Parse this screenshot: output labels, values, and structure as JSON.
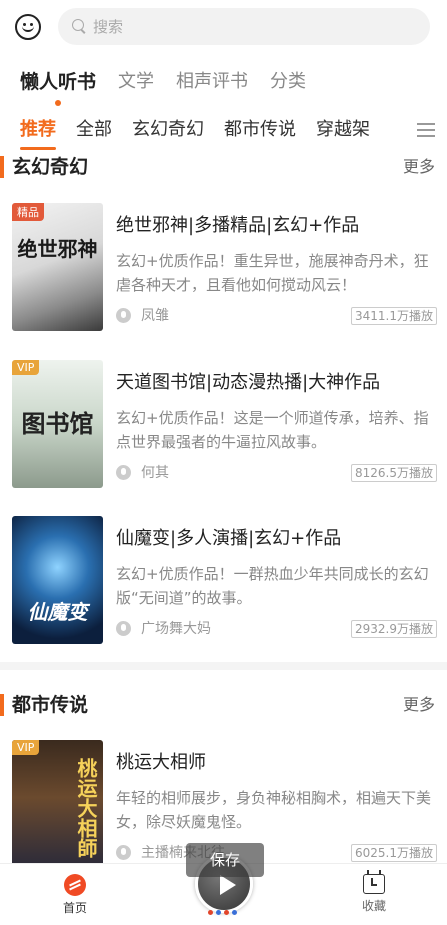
{
  "header": {
    "search_placeholder": "搜索"
  },
  "top_tabs": [
    {
      "label": "懒人听书",
      "active": true
    },
    {
      "label": "文学",
      "active": false
    },
    {
      "label": "相声评书",
      "active": false
    },
    {
      "label": "分类",
      "active": false
    }
  ],
  "sub_tabs": [
    {
      "label": "推荐",
      "active": true
    },
    {
      "label": "全部",
      "active": false
    },
    {
      "label": "玄幻奇幻",
      "active": false
    },
    {
      "label": "都市传说",
      "active": false
    },
    {
      "label": "穿越架",
      "active": false
    }
  ],
  "sections": [
    {
      "title": "玄幻奇幻",
      "more": "更多",
      "books": [
        {
          "badge": "精品",
          "cover_text": "绝世邪神",
          "title": "绝世邪神|多播精品|玄幻+作品",
          "desc": "玄幻+优质作品！重生异世，施展神奇丹术，狂虐各种天才，且看他如何搅动风云！",
          "author": "凤雏",
          "plays": "3411.1万播放"
        },
        {
          "badge": "VIP",
          "cover_text": "图书馆",
          "title": "天道图书馆|动态漫热播|大神作品",
          "desc": "玄幻+优质作品！这是一个师道传承，培养、指点世界最强者的牛逼拉风故事。",
          "author": "何其",
          "plays": "8126.5万播放"
        },
        {
          "badge": "",
          "cover_text": "仙魔变",
          "title": "仙魔变|多人演播|玄幻+作品",
          "desc": "玄幻+优质作品！一群热血少年共同成长的玄幻版“无间道”的故事。",
          "author": "广场舞大妈",
          "plays": "2932.9万播放"
        }
      ]
    },
    {
      "title": "都市传说",
      "more": "更多",
      "books": [
        {
          "badge": "VIP",
          "cover_text": "桃运大相師",
          "title": "桃运大相师",
          "desc": "年轻的相师展步，身负神秘相胸术，相遍天下美女，除尽妖魔鬼怪。",
          "author": "主播楠来北往",
          "plays": "6025.1万播放"
        }
      ]
    }
  ],
  "player": {
    "save_toast": "保存"
  },
  "bottom_nav": {
    "home_label": "首页",
    "favorites_label": "收藏"
  },
  "colors": {
    "accent": "#f26b1d",
    "home_icon": "#f04a24"
  }
}
